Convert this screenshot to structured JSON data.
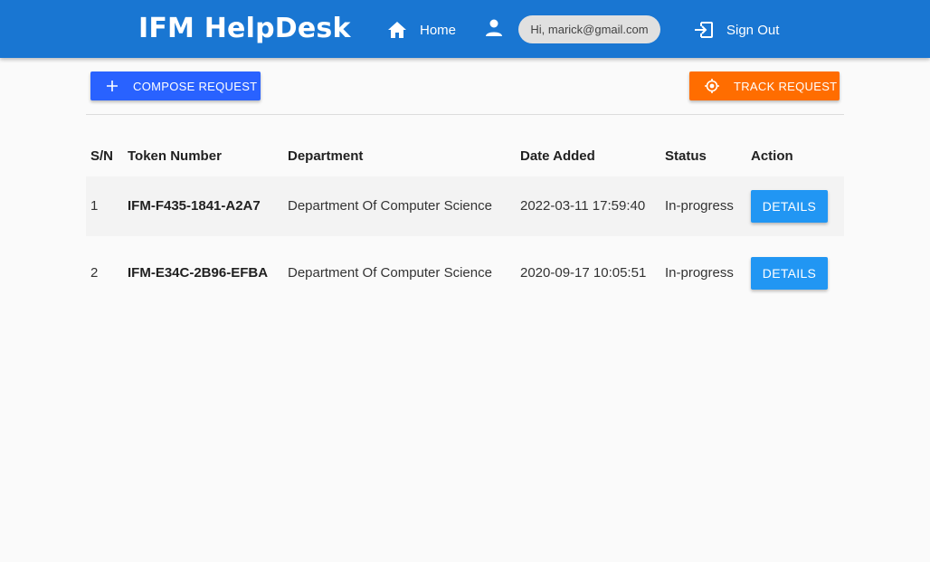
{
  "header": {
    "brand": "IFM HelpDesk",
    "home_label": "Home",
    "user_greeting": "Hi, marick@gmail.com",
    "signout_label": "Sign Out",
    "bg_color": "#1976d2"
  },
  "toolbar": {
    "compose_label": "COMPOSE REQUEST",
    "compose_icon": "plus-icon",
    "compose_color": "#2962ff",
    "track_label": "TRACK REQUEST",
    "track_icon": "gps-target-icon",
    "track_color": "#ff6d00"
  },
  "table": {
    "headers": [
      "S/N",
      "Token Number",
      "Department",
      "Date Added",
      "Status",
      "Action"
    ],
    "rows": [
      {
        "sn": "1",
        "token": "IFM-F435-1841-A2A7",
        "department": "Department Of Computer Science",
        "date": "2022-03-11 17:59:40",
        "status": "In-progress",
        "action": "DETAILS"
      },
      {
        "sn": "2",
        "token": "IFM-E34C-2B96-EFBA",
        "department": "Department Of Computer Science",
        "date": "2020-09-17 10:05:51",
        "status": "In-progress",
        "action": "DETAILS"
      }
    ]
  }
}
